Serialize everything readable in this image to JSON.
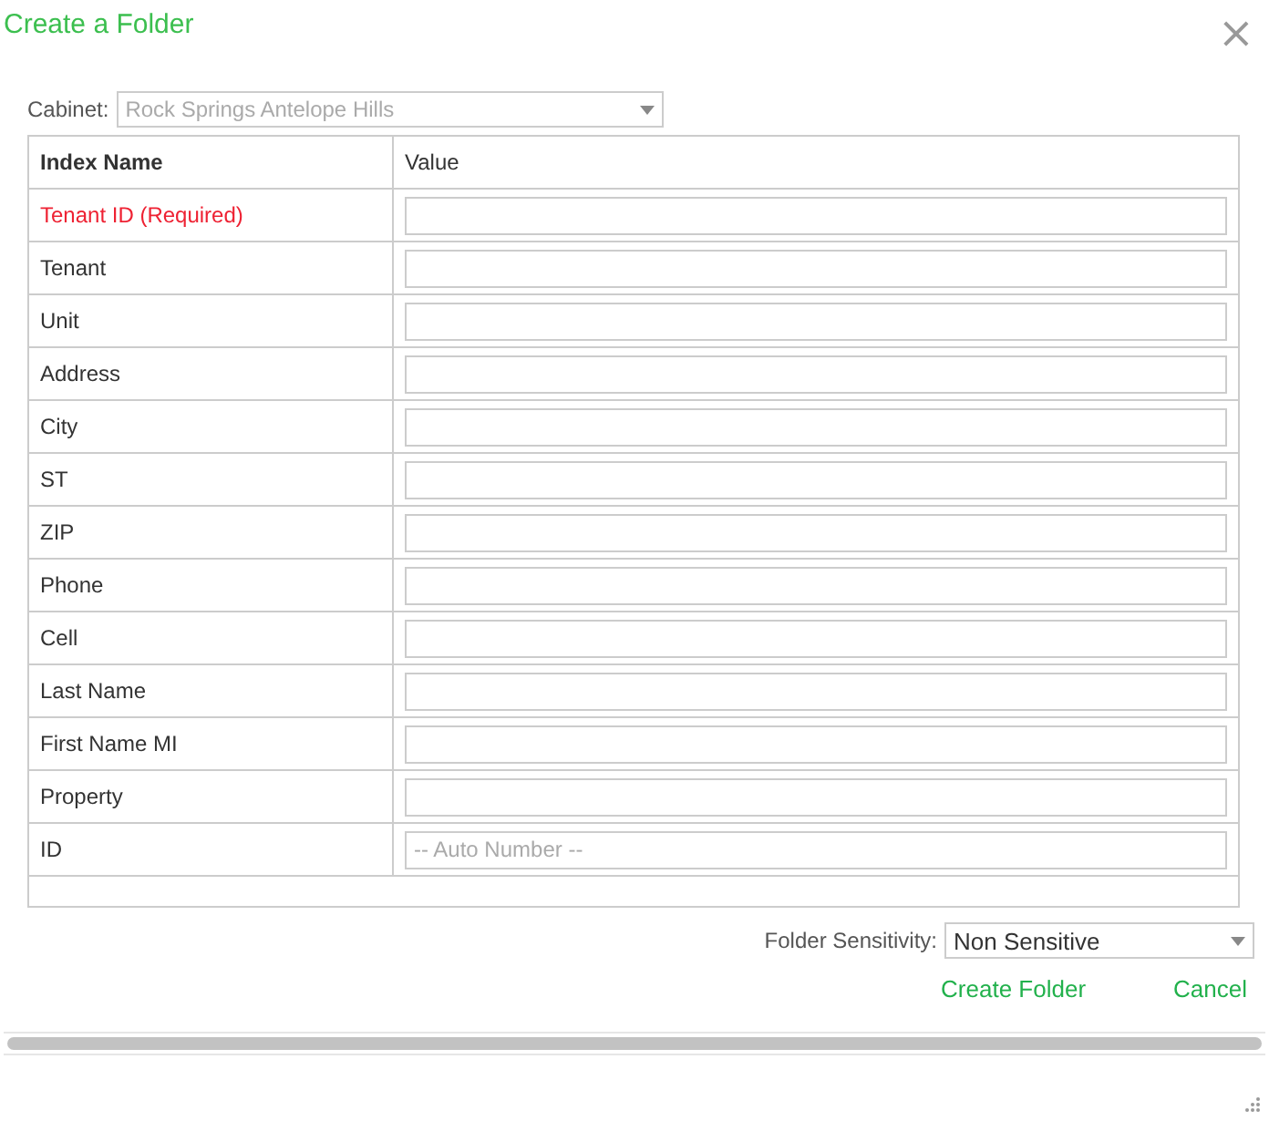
{
  "dialog": {
    "title": "Create a Folder",
    "close_icon": "×"
  },
  "cabinet": {
    "label": "Cabinet:",
    "value": "Rock Springs Antelope Hills",
    "disabled": true
  },
  "table": {
    "columns": [
      "Index Name",
      "Value"
    ],
    "rows": [
      {
        "name": "Tenant ID (Required)",
        "required": true
      },
      {
        "name": "Tenant",
        "required": false
      },
      {
        "name": "Unit",
        "required": false
      },
      {
        "name": "Address",
        "required": false
      },
      {
        "name": "City",
        "required": false
      },
      {
        "name": "ST",
        "required": false
      },
      {
        "name": "ZIP",
        "required": false
      },
      {
        "name": "Phone",
        "required": false
      },
      {
        "name": "Cell",
        "required": false
      },
      {
        "name": "Last Name",
        "required": false
      },
      {
        "name": "First Name MI",
        "required": false
      },
      {
        "name": "Property",
        "required": false
      },
      {
        "name": "ID",
        "required": false,
        "placeholder": "-- Auto Number --"
      }
    ]
  },
  "sensitivity": {
    "label": "Folder Sensitivity:",
    "value": "Non Sensitive"
  },
  "buttons": [
    "Create Folder",
    "Cancel"
  ]
}
